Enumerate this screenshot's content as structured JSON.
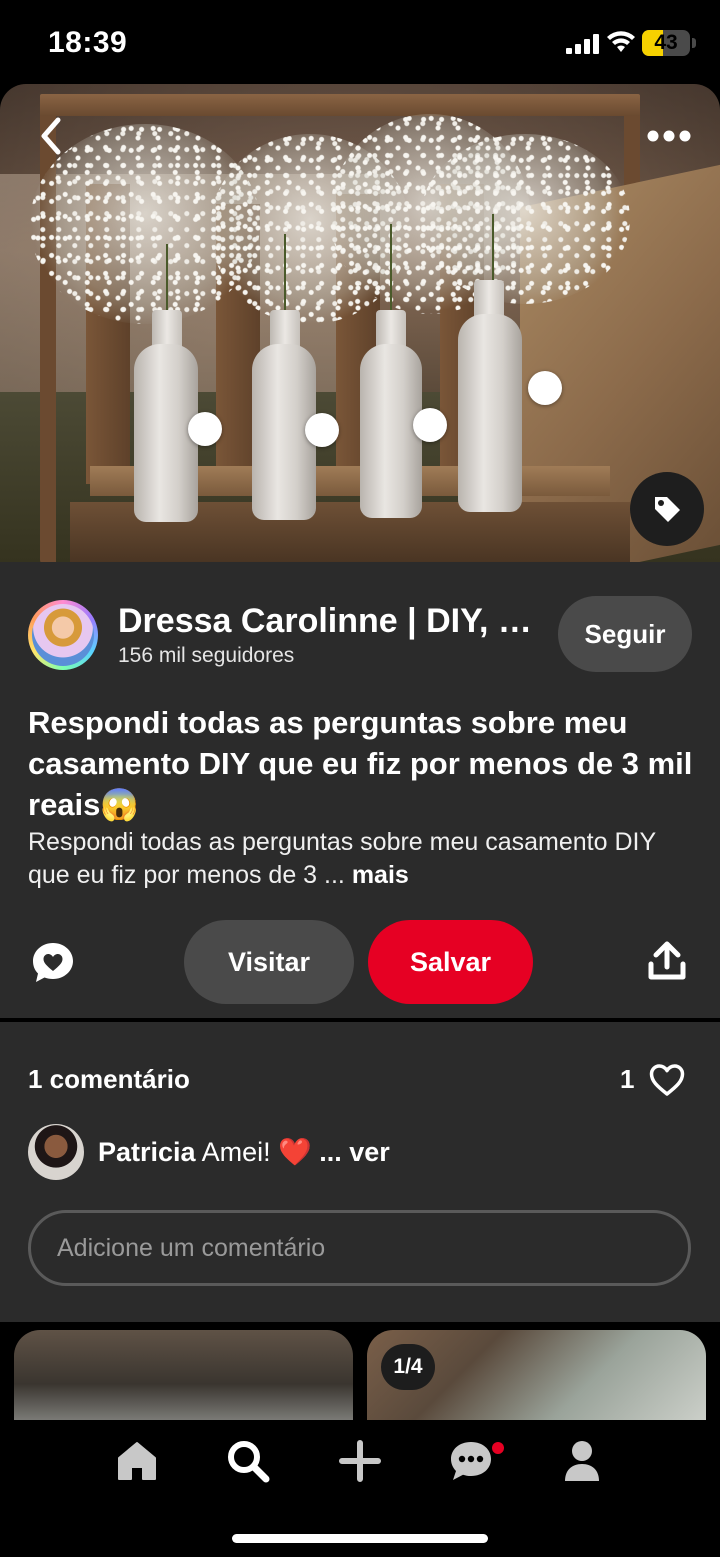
{
  "status_bar": {
    "time": "18:39",
    "battery": "43",
    "battery_level": 0.43
  },
  "pin": {
    "image_alt": "Garrafas brancas com flores mosquitinho em caixotes de madeira",
    "author": {
      "name": "Dressa Carolinne | DIY, casamento",
      "followers": "156 mil seguidores"
    },
    "follow_label": "Seguir",
    "title": "Respondi todas as perguntas sobre meu casamento DIY que eu fiz por menos de 3 mil reais😱",
    "description": "Respondi todas as perguntas sobre meu casamento DIY que eu fiz por menos de 3 ...",
    "more_label": "mais",
    "visit_label": "Visitar",
    "save_label": "Salvar"
  },
  "comments": {
    "count_label": "1 comentário",
    "likes": "1",
    "first": {
      "author": "Patricia",
      "text": "Amei! ❤️",
      "more": "... ver"
    },
    "input_placeholder": "Adicione um comentário"
  },
  "related": {
    "page_badge": "1/4"
  },
  "icons": {
    "back": "chevron-left-icon",
    "more": "more-horizontal-icon",
    "tag": "tag-icon",
    "comment": "comment-heart-icon",
    "share": "share-icon",
    "like": "heart-outline-icon",
    "nav": [
      "home-icon",
      "search-icon",
      "plus-icon",
      "messages-icon",
      "profile-icon"
    ]
  },
  "colors": {
    "accent": "#e60023",
    "panel": "#2b2b2b",
    "button_secondary": "#4a4a4a",
    "battery": "#f6d100"
  }
}
